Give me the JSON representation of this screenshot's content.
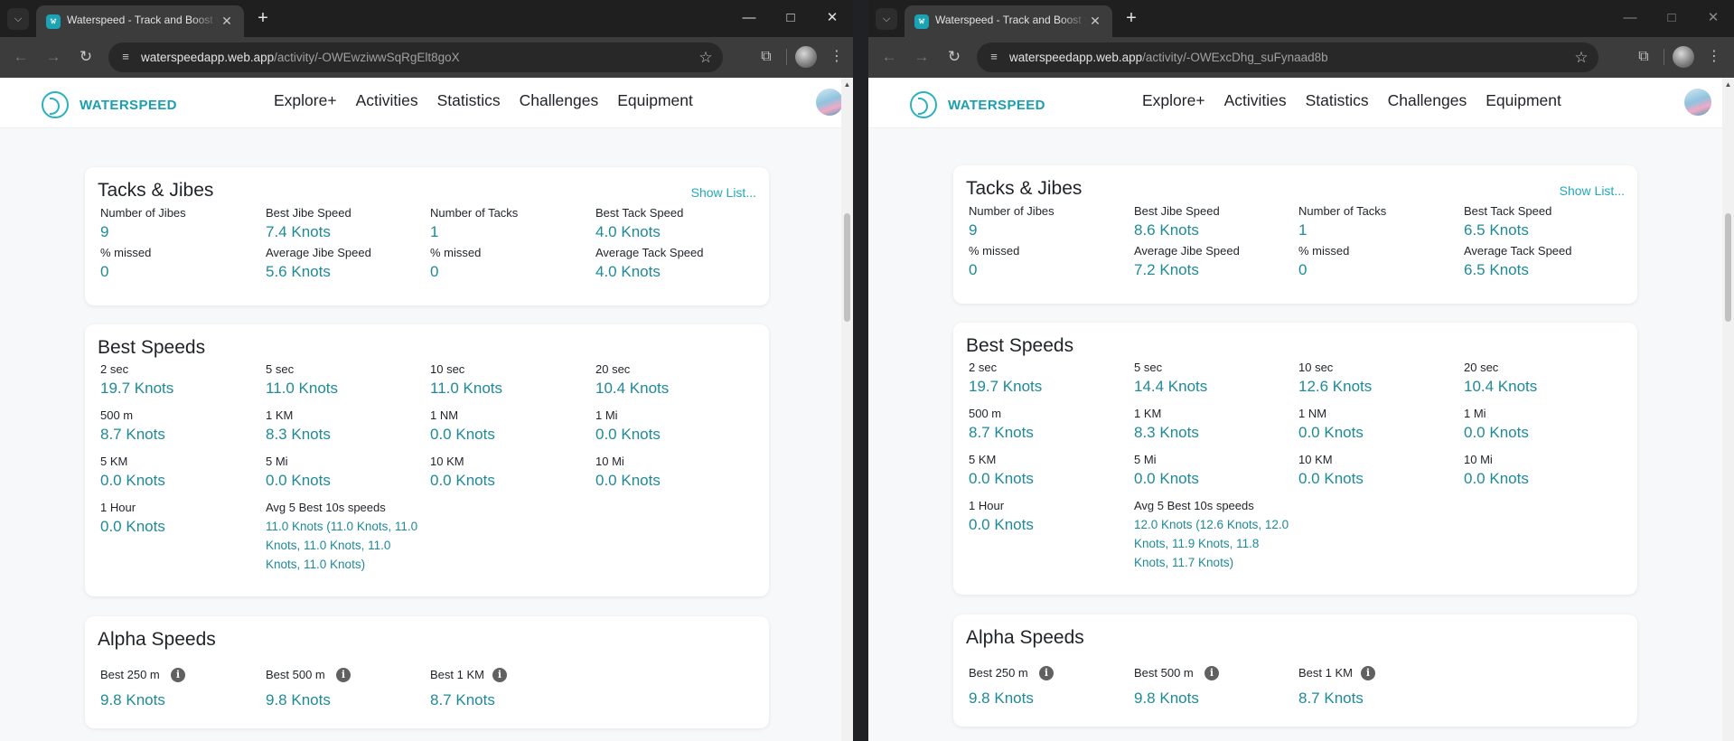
{
  "windows": [
    {
      "tab_title": "Waterspeed - Track and Boost y",
      "url_host": "waterspeedapp.web.app",
      "url_path": "/activity/-OWEwziwwSqRgElt8goX",
      "app": {
        "brand": "WATERSPEED",
        "nav": [
          "Explore+",
          "Activities",
          "Statistics",
          "Challenges",
          "Equipment"
        ]
      },
      "tacks": {
        "title": "Tacks & Jibes",
        "show_list": "Show List...",
        "stats": [
          {
            "label": "Number of Jibes",
            "value": "9"
          },
          {
            "label": "Best Jibe Speed",
            "value": "7.4 Knots"
          },
          {
            "label": "Number of Tacks",
            "value": "1"
          },
          {
            "label": "Best Tack Speed",
            "value": "4.0 Knots"
          },
          {
            "label": "% missed",
            "value": "0"
          },
          {
            "label": "Average Jibe Speed",
            "value": "5.6 Knots"
          },
          {
            "label": "% missed",
            "value": "0"
          },
          {
            "label": "Average Tack Speed",
            "value": "4.0 Knots"
          }
        ]
      },
      "best": {
        "title": "Best Speeds",
        "stats": [
          {
            "label": "2 sec",
            "value": "19.7 Knots"
          },
          {
            "label": "5 sec",
            "value": "11.0 Knots"
          },
          {
            "label": "10 sec",
            "value": "11.0 Knots"
          },
          {
            "label": "20 sec",
            "value": "10.4 Knots"
          },
          {
            "label": "500 m",
            "value": "8.7 Knots"
          },
          {
            "label": "1 KM",
            "value": "8.3 Knots"
          },
          {
            "label": "1 NM",
            "value": "0.0 Knots"
          },
          {
            "label": "1 Mi",
            "value": "0.0 Knots"
          },
          {
            "label": "5 KM",
            "value": "0.0 Knots"
          },
          {
            "label": "5 Mi",
            "value": "0.0 Knots"
          },
          {
            "label": "10 KM",
            "value": "0.0 Knots"
          },
          {
            "label": "10 Mi",
            "value": "0.0 Knots"
          },
          {
            "label": "1 Hour",
            "value": "0.0 Knots"
          }
        ],
        "avg_label": "Avg 5 Best 10s speeds",
        "avg_value": "11.0 Knots (11.0 Knots, 11.0 Knots, 11.0 Knots, 11.0 Knots, 11.0 Knots)"
      },
      "alpha": {
        "title": "Alpha Speeds",
        "stats": [
          {
            "label": "Best 250 m",
            "value": "9.8 Knots"
          },
          {
            "label": "Best 500 m",
            "value": "9.8 Knots"
          },
          {
            "label": "Best 1 KM",
            "value": "8.7 Knots"
          }
        ]
      }
    },
    {
      "tab_title": "Waterspeed - Track and Boost y",
      "url_host": "waterspeedapp.web.app",
      "url_path": "/activity/-OWExcDhg_suFynaad8b",
      "app": {
        "brand": "WATERSPEED",
        "nav": [
          "Explore+",
          "Activities",
          "Statistics",
          "Challenges",
          "Equipment"
        ]
      },
      "tacks": {
        "title": "Tacks & Jibes",
        "show_list": "Show List...",
        "stats": [
          {
            "label": "Number of Jibes",
            "value": "9"
          },
          {
            "label": "Best Jibe Speed",
            "value": "8.6 Knots"
          },
          {
            "label": "Number of Tacks",
            "value": "1"
          },
          {
            "label": "Best Tack Speed",
            "value": "6.5 Knots"
          },
          {
            "label": "% missed",
            "value": "0"
          },
          {
            "label": "Average Jibe Speed",
            "value": "7.2 Knots"
          },
          {
            "label": "% missed",
            "value": "0"
          },
          {
            "label": "Average Tack Speed",
            "value": "6.5 Knots"
          }
        ]
      },
      "best": {
        "title": "Best Speeds",
        "stats": [
          {
            "label": "2 sec",
            "value": "19.7 Knots"
          },
          {
            "label": "5 sec",
            "value": "14.4 Knots"
          },
          {
            "label": "10 sec",
            "value": "12.6 Knots"
          },
          {
            "label": "20 sec",
            "value": "10.4 Knots"
          },
          {
            "label": "500 m",
            "value": "8.7 Knots"
          },
          {
            "label": "1 KM",
            "value": "8.3 Knots"
          },
          {
            "label": "1 NM",
            "value": "0.0 Knots"
          },
          {
            "label": "1 Mi",
            "value": "0.0 Knots"
          },
          {
            "label": "5 KM",
            "value": "0.0 Knots"
          },
          {
            "label": "5 Mi",
            "value": "0.0 Knots"
          },
          {
            "label": "10 KM",
            "value": "0.0 Knots"
          },
          {
            "label": "10 Mi",
            "value": "0.0 Knots"
          },
          {
            "label": "1 Hour",
            "value": "0.0 Knots"
          }
        ],
        "avg_label": "Avg 5 Best 10s speeds",
        "avg_value": "12.0 Knots (12.6 Knots, 12.0 Knots, 11.9 Knots, 11.8 Knots, 11.7 Knots)"
      },
      "alpha": {
        "title": "Alpha Speeds",
        "stats": [
          {
            "label": "Best 250 m",
            "value": "9.8 Knots"
          },
          {
            "label": "Best 500 m",
            "value": "9.8 Knots"
          },
          {
            "label": "Best 1 KM",
            "value": "8.7 Knots"
          }
        ]
      }
    }
  ],
  "icons": {
    "tab_menu": "chevron-down-icon",
    "favicon": "waterspeed-favicon",
    "tab_close": "close-icon",
    "new_tab": "plus-icon",
    "minimize": "minimize-icon",
    "maximize": "maximize-icon",
    "close": "close-icon",
    "back": "arrow-left-icon",
    "forward": "arrow-right-icon",
    "reload": "reload-icon",
    "site_info": "tune-icon",
    "bookmark": "star-icon",
    "extensions": "puzzle-icon",
    "menu": "kebab-menu-icon",
    "info": "info-icon"
  },
  "colors": {
    "accent": "#22a9b7",
    "value_teal": "#1f8a97",
    "chrome_dark": "#1f1f1f",
    "toolbar": "#3c3c3c"
  }
}
